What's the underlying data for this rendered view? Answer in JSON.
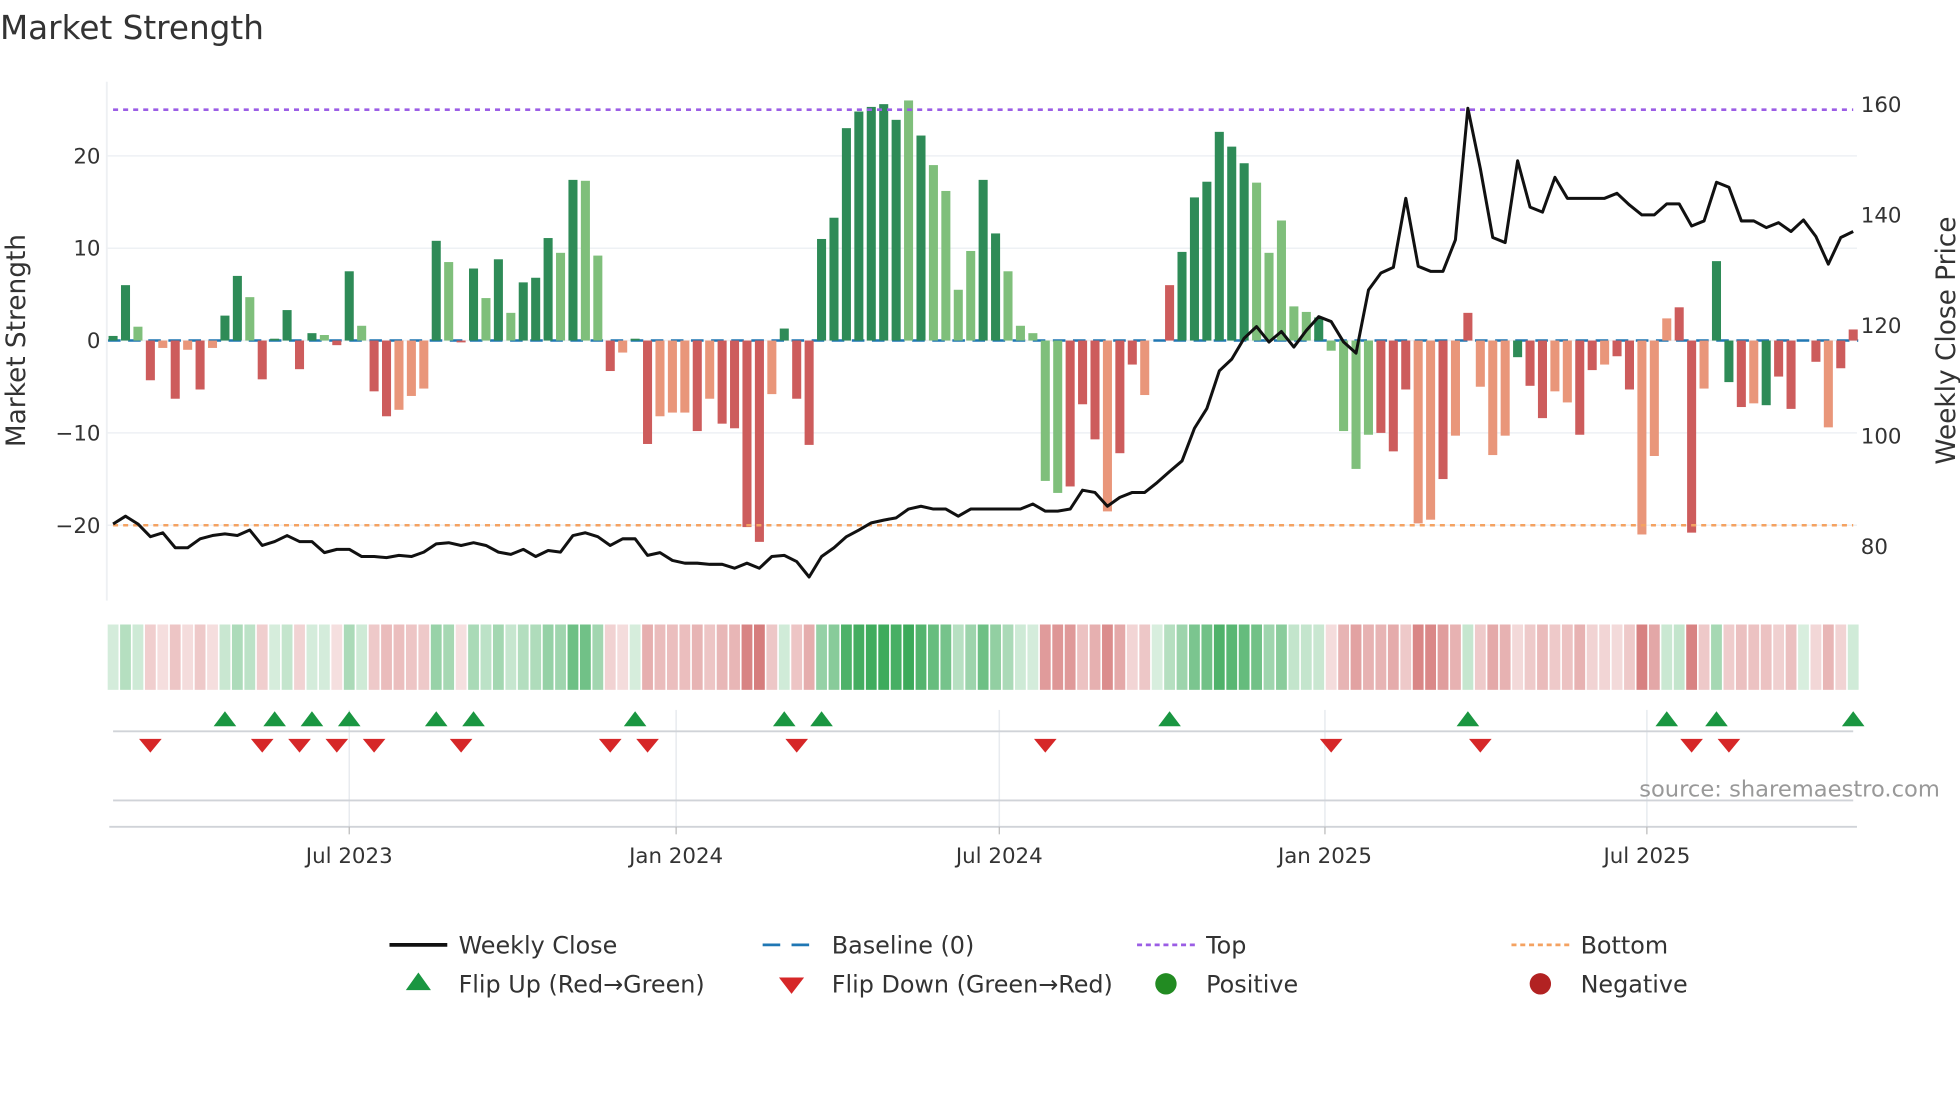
{
  "chart_data": {
    "type": "bar",
    "title": "Market Strength",
    "ylabel": "Market Strength",
    "y2label": "Weekly Close Price",
    "ylim": [
      -28,
      28
    ],
    "y2lim": [
      69.2,
      164.2
    ],
    "yticks": [
      "20",
      "10",
      "0",
      "−10",
      "−20"
    ],
    "ytick_values": [
      20,
      10,
      0,
      -10,
      -20
    ],
    "y2ticks": [
      "160",
      "140",
      "120",
      "100",
      "80"
    ],
    "y2tick_values": [
      160,
      140,
      120,
      100,
      80
    ],
    "xticks": [
      "Jul 2023",
      "Jan 2024",
      "Jul 2024",
      "Jan 2025",
      "Jul 2025"
    ],
    "xtick_week_index": [
      19,
      45.3,
      71.3,
      97.5,
      123.4
    ],
    "top_level": 25,
    "bottom_level": -20,
    "baseline": 0,
    "strength": [
      0.5,
      6,
      1.5,
      -4.3,
      -0.8,
      -6.3,
      -1,
      -5.3,
      -0.8,
      2.7,
      7,
      4.7,
      -4.2,
      0.2,
      3.3,
      -3.1,
      0.8,
      0.6,
      -0.5,
      7.5,
      1.6,
      -5.5,
      -8.2,
      -7.5,
      -6,
      -5.2,
      10.8,
      8.5,
      -0.2,
      7.8,
      4.6,
      8.8,
      3,
      6.3,
      6.8,
      11.1,
      9.5,
      17.4,
      17.3,
      9.2,
      -3.3,
      -1.3,
      0.2,
      -11.2,
      -8.2,
      -7.8,
      -7.8,
      -9.8,
      -6.3,
      -9,
      -9.5,
      -20.2,
      -21.8,
      -5.8,
      1.3,
      -6.3,
      -11.3,
      11,
      13.3,
      23,
      24.8,
      25.3,
      25.6,
      23.9,
      26,
      22.2,
      19,
      16.2,
      5.5,
      9.7,
      17.4,
      11.6,
      7.5,
      1.6,
      0.8,
      -15.2,
      -16.5,
      -15.8,
      -6.9,
      -10.7,
      -18.5,
      -12.2,
      -2.6,
      -5.9,
      0,
      6,
      9.6,
      15.5,
      17.2,
      22.6,
      21,
      19.2,
      17.1,
      9.5,
      13,
      3.7,
      3.1,
      2.5,
      -1.1,
      -9.8,
      -13.9,
      -10.2,
      -10,
      -12,
      -5.3,
      -19.8,
      -19.4,
      -15,
      -10.3,
      3,
      -5,
      -12.4,
      -10.3,
      -1.8,
      -4.9,
      -8.4,
      -5.5,
      -6.7,
      -10.2,
      -3.2,
      -2.6,
      -1.7,
      -5.3,
      -21,
      -12.5,
      2.4,
      3.6,
      -20.8,
      -5.2,
      8.6,
      -4.5,
      -7.2,
      -6.8,
      -7,
      -3.9,
      -7.4,
      0,
      -2.3,
      -9.4,
      -3,
      1.2
    ],
    "strength_tone": "ddlrsrsrsddlrddrdlrdlrrsssdlrdldldddldllrsdrsssrsrrrrsdrrdddddddldllllddlllllrrrsrrsrrddddddllllldllllrrrssrsrsssdrrssrrsrrsssrrsddrsdrrsrsrrrrs",
    "weekly_close": [
      84.1,
      85.5,
      84.1,
      81.8,
      82.5,
      79.8,
      79.8,
      81.4,
      82,
      82.3,
      82,
      83,
      80.2,
      80.9,
      82,
      80.9,
      80.9,
      78.9,
      79.5,
      79.5,
      78.2,
      78.2,
      78,
      78.4,
      78.2,
      79,
      80.5,
      80.7,
      80.2,
      80.7,
      80.2,
      79,
      78.6,
      79.5,
      78.2,
      79.3,
      79,
      82,
      82.5,
      81.8,
      80.2,
      81.4,
      81.4,
      78.4,
      78.9,
      77.5,
      77,
      77,
      76.8,
      76.8,
      76.1,
      77,
      76.1,
      78.2,
      78.4,
      77.3,
      74.5,
      78.2,
      79.8,
      81.8,
      83,
      84.3,
      84.8,
      85.2,
      86.8,
      87.3,
      86.8,
      86.8,
      85.5,
      86.8,
      86.8,
      86.8,
      86.8,
      86.8,
      87.7,
      86.4,
      86.4,
      86.8,
      90.2,
      89.8,
      87.3,
      88.9,
      89.8,
      89.8,
      91.6,
      93.6,
      95.5,
      101.4,
      105,
      111.8,
      113.9,
      117.7,
      119.8,
      117,
      118.9,
      116.1,
      119.1,
      121.6,
      120.7,
      117,
      115,
      126.4,
      129.5,
      130.5,
      143,
      130.7,
      129.8,
      129.8,
      135.5,
      159.3,
      148.4,
      135.9,
      135,
      149.8,
      141.4,
      140.5,
      146.8,
      143,
      143,
      143,
      143,
      143.9,
      141.8,
      140,
      140,
      142,
      142,
      138,
      138.9,
      145.9,
      145,
      138.9,
      138.9,
      137.7,
      138.6,
      137,
      139.1,
      136.1,
      131.1,
      135.9,
      137
    ],
    "flip_up_week_index": [
      9,
      13,
      16,
      19,
      26,
      29,
      42,
      54,
      57,
      85,
      109,
      125,
      129,
      140
    ],
    "flip_down_week_index": [
      3,
      12,
      15,
      18,
      21,
      28,
      40,
      43,
      55,
      75,
      98,
      110,
      127,
      130
    ],
    "legend": {
      "placement": "bottom",
      "items": [
        {
          "label": "Weekly Close",
          "kind": "line-solid",
          "color": "#111111"
        },
        {
          "label": "Baseline (0)",
          "kind": "line-dash",
          "color": "#1f77b4"
        },
        {
          "label": "Top",
          "kind": "line-dot",
          "color": "#9b5de5"
        },
        {
          "label": "Bottom",
          "kind": "line-dot",
          "color": "#f4a261"
        },
        {
          "label": "Flip Up (Red→Green)",
          "kind": "tri-up",
          "color": "#1a9641"
        },
        {
          "label": "Flip Down (Green→Red)",
          "kind": "tri-down",
          "color": "#d62728"
        },
        {
          "label": "Positive",
          "kind": "dot",
          "color": "#228b22"
        },
        {
          "label": "Negative",
          "kind": "dot",
          "color": "#b22222"
        }
      ]
    },
    "colors": {
      "pos_dark": "#2e8b57",
      "pos_light": "#7fbf7b",
      "neg_dark": "#cd5c5c",
      "neg_light": "#e9967a",
      "line": "#111111",
      "top": "#9b5de5",
      "bottom": "#f4a261",
      "baseline": "#1f77b4",
      "flip_up": "#1a9641",
      "flip_down": "#d62728"
    },
    "source": "source: sharemaestro.com"
  }
}
